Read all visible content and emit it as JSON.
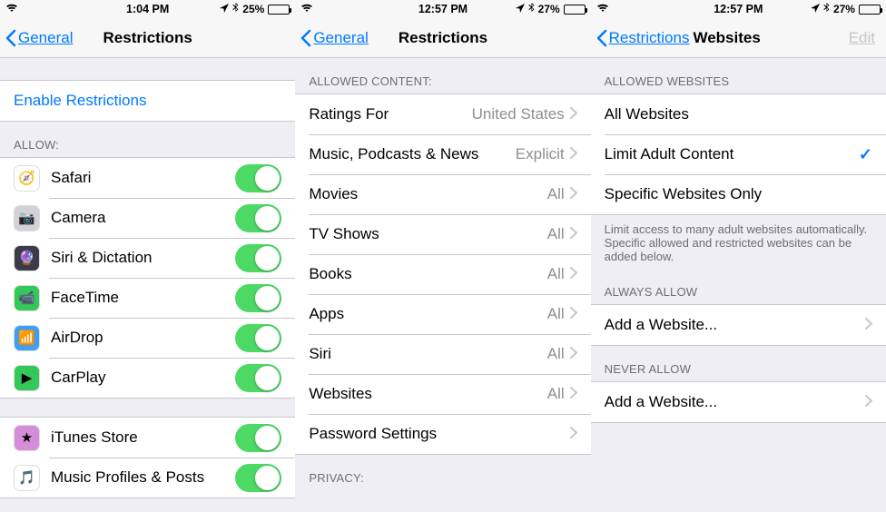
{
  "screens": {
    "a": {
      "status": {
        "time": "1:04 PM",
        "battery_pct": "25%",
        "battery_fill": "25%"
      },
      "nav": {
        "back": "General",
        "title": "Restrictions"
      },
      "enable_label": "Enable Restrictions",
      "allow_header": "ALLOW:",
      "allow_rows": [
        {
          "label": "Safari",
          "color": "#ffffff",
          "emoji": "🧭"
        },
        {
          "label": "Camera",
          "color": "#d2d2d6",
          "emoji": "📷"
        },
        {
          "label": "Siri & Dictation",
          "color": "#3b3b4a",
          "emoji": "🔮"
        },
        {
          "label": "FaceTime",
          "color": "#34c759",
          "emoji": "📹"
        },
        {
          "label": "AirDrop",
          "color": "#3ba0f5",
          "emoji": "📶"
        },
        {
          "label": "CarPlay",
          "color": "#34c759",
          "emoji": "▶︎"
        }
      ],
      "allow_rows2": [
        {
          "label": "iTunes Store",
          "color": "#d58cd9",
          "emoji": "★"
        },
        {
          "label": "Music Profiles & Posts",
          "color": "#ffffff",
          "emoji": "🎵"
        }
      ]
    },
    "b": {
      "status": {
        "time": "12:57 PM",
        "battery_pct": "27%",
        "battery_fill": "27%"
      },
      "nav": {
        "back": "General",
        "title": "Restrictions"
      },
      "header": "ALLOWED CONTENT:",
      "rows": [
        {
          "label": "Ratings For",
          "value": "United States"
        },
        {
          "label": "Music, Podcasts & News",
          "value": "Explicit"
        },
        {
          "label": "Movies",
          "value": "All"
        },
        {
          "label": "TV Shows",
          "value": "All"
        },
        {
          "label": "Books",
          "value": "All"
        },
        {
          "label": "Apps",
          "value": "All"
        },
        {
          "label": "Siri",
          "value": "All"
        },
        {
          "label": "Websites",
          "value": "All"
        },
        {
          "label": "Password Settings",
          "value": ""
        }
      ],
      "footer_header": "PRIVACY:"
    },
    "c": {
      "status": {
        "time": "12:57 PM",
        "battery_pct": "27%",
        "battery_fill": "27%"
      },
      "nav": {
        "back": "Restrictions",
        "title": "Websites",
        "edit": "Edit"
      },
      "header1": "ALLOWED WEBSITES",
      "options": [
        {
          "label": "All Websites"
        },
        {
          "label": "Limit Adult Content",
          "checked": true
        },
        {
          "label": "Specific Websites Only"
        }
      ],
      "footer1": "Limit access to many adult websites automatically. Specific allowed and restricted websites can be added below.",
      "header2": "ALWAYS ALLOW",
      "add_label": "Add a Website...",
      "header3": "NEVER ALLOW"
    }
  }
}
